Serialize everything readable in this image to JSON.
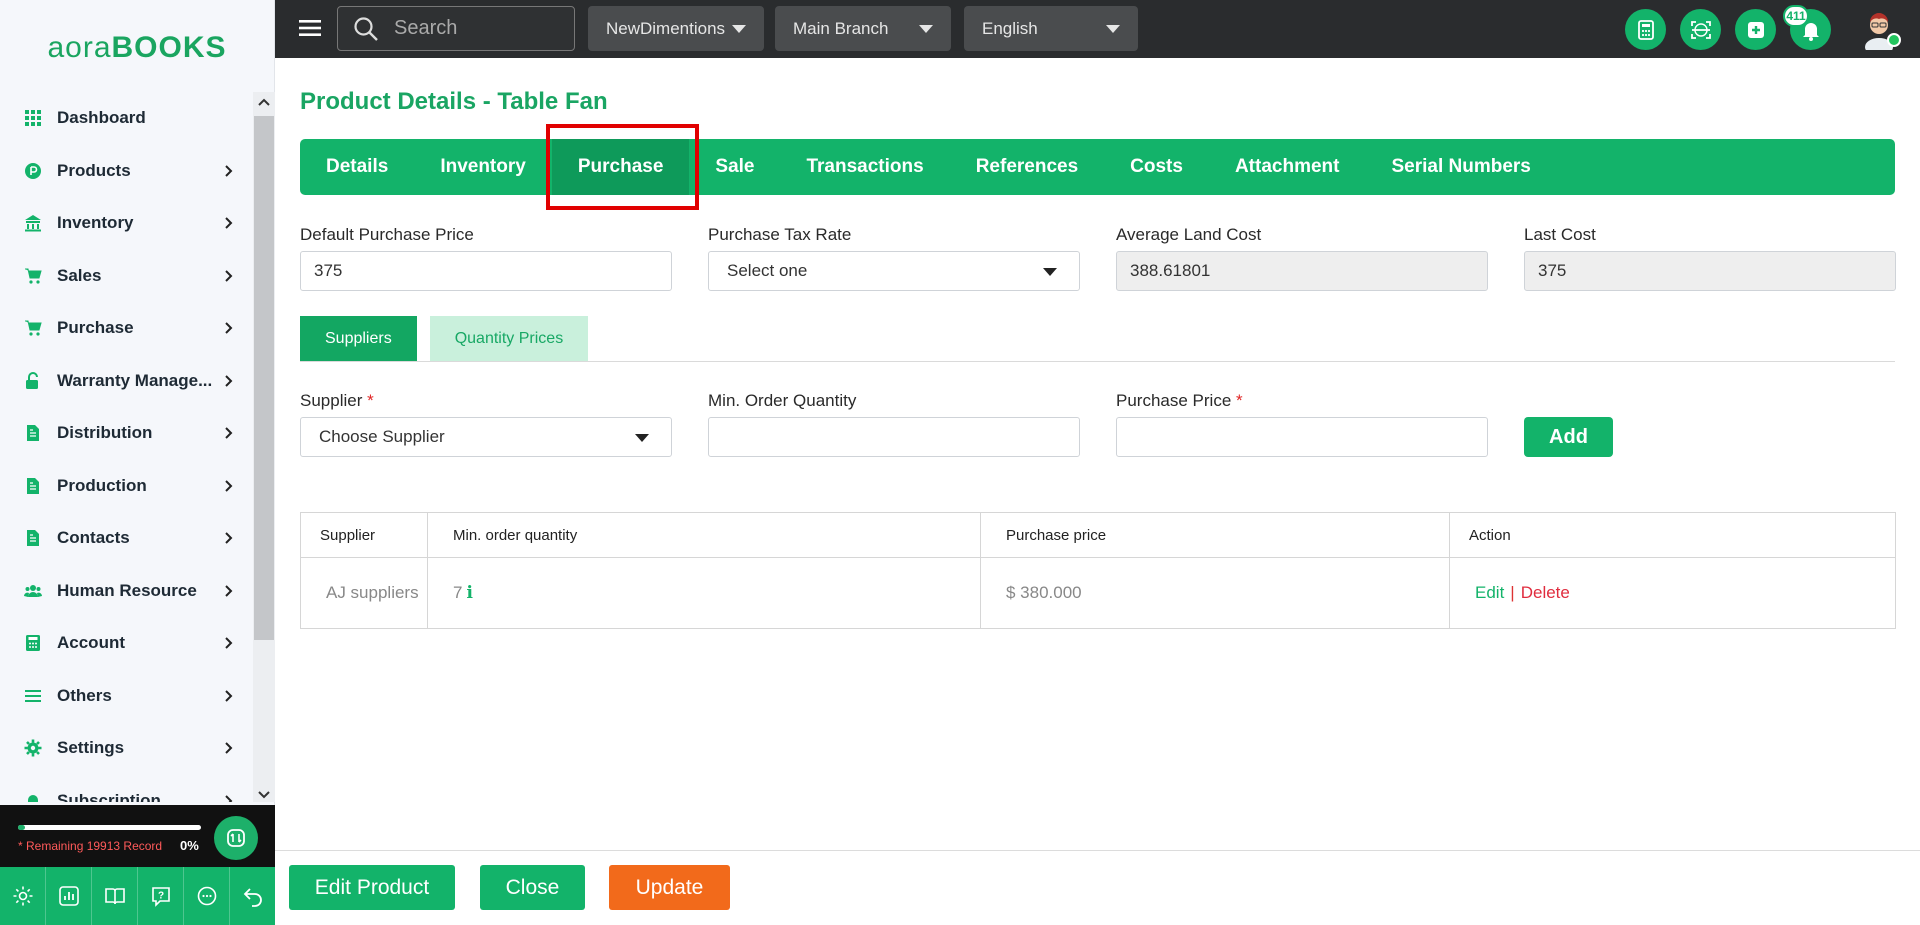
{
  "brand": {
    "logo_part1": "aora",
    "logo_part2": "BOOKS",
    "accent": "#13b36a",
    "danger": "#e02c3e",
    "update_color": "#f26a1b"
  },
  "sidebar": {
    "items": [
      {
        "label": "Dashboard",
        "icon": "grid-icon",
        "has_chevron": false
      },
      {
        "label": "Products",
        "icon": "product-icon",
        "has_chevron": true
      },
      {
        "label": "Inventory",
        "icon": "warehouse-icon",
        "has_chevron": true
      },
      {
        "label": "Sales",
        "icon": "cart-icon",
        "has_chevron": true
      },
      {
        "label": "Purchase",
        "icon": "cart-icon",
        "has_chevron": true
      },
      {
        "label": "Warranty Manage...",
        "icon": "unlock-icon",
        "has_chevron": true
      },
      {
        "label": "Distribution",
        "icon": "document-icon",
        "has_chevron": true
      },
      {
        "label": "Production",
        "icon": "document-icon",
        "has_chevron": true
      },
      {
        "label": "Contacts",
        "icon": "document-icon",
        "has_chevron": true
      },
      {
        "label": "Human Resource",
        "icon": "users-icon",
        "has_chevron": true
      },
      {
        "label": "Account",
        "icon": "calculator-icon",
        "has_chevron": true
      },
      {
        "label": "Others",
        "icon": "list-icon",
        "has_chevron": true
      },
      {
        "label": "Settings",
        "icon": "gear-icon",
        "has_chevron": true
      },
      {
        "label": "Subscription",
        "icon": "bell-icon",
        "has_chevron": true
      }
    ],
    "remaining_text": "* Remaining 19913 Record",
    "progress_percent_text": "0%",
    "progress_fraction": 0.04
  },
  "topbar": {
    "search_placeholder": "Search",
    "company": "NewDimentions",
    "branch": "Main Branch",
    "language": "English",
    "notification_count": "411"
  },
  "main": {
    "title": "Product Details - Table Fan",
    "tabs": [
      {
        "label": "Details",
        "active": false
      },
      {
        "label": "Inventory",
        "active": false
      },
      {
        "label": "Purchase",
        "active": true
      },
      {
        "label": "Sale",
        "active": false
      },
      {
        "label": "Transactions",
        "active": false
      },
      {
        "label": "References",
        "active": false
      },
      {
        "label": "Costs",
        "active": false
      },
      {
        "label": "Attachment",
        "active": false
      },
      {
        "label": "Serial Numbers",
        "active": false
      }
    ],
    "fields": {
      "default_purchase_price": {
        "label": "Default Purchase Price",
        "value": "375"
      },
      "purchase_tax_rate": {
        "label": "Purchase Tax Rate",
        "value": "Select one"
      },
      "average_land_cost": {
        "label": "Average Land Cost",
        "value": "388.61801"
      },
      "last_cost": {
        "label": "Last Cost",
        "value": "375"
      }
    },
    "subtabs": {
      "suppliers": "Suppliers",
      "quantity_prices": "Quantity Prices"
    },
    "supplier_form": {
      "supplier_label": "Supplier",
      "supplier_placeholder": "Choose Supplier",
      "min_order_label": "Min. Order Quantity",
      "purchase_price_label": "Purchase Price",
      "required_mark": "*",
      "add_label": "Add"
    },
    "table": {
      "headers": [
        "Supplier",
        "Min. order quantity",
        "Purchase price",
        "Action"
      ],
      "rows": [
        {
          "supplier": "AJ suppliers",
          "min_qty": "7",
          "info": "i",
          "price": "$ 380.000",
          "edit": "Edit",
          "sep": "|",
          "delete": "Delete"
        }
      ]
    }
  },
  "footer": {
    "edit_product": "Edit Product",
    "close": "Close",
    "update": "Update"
  }
}
